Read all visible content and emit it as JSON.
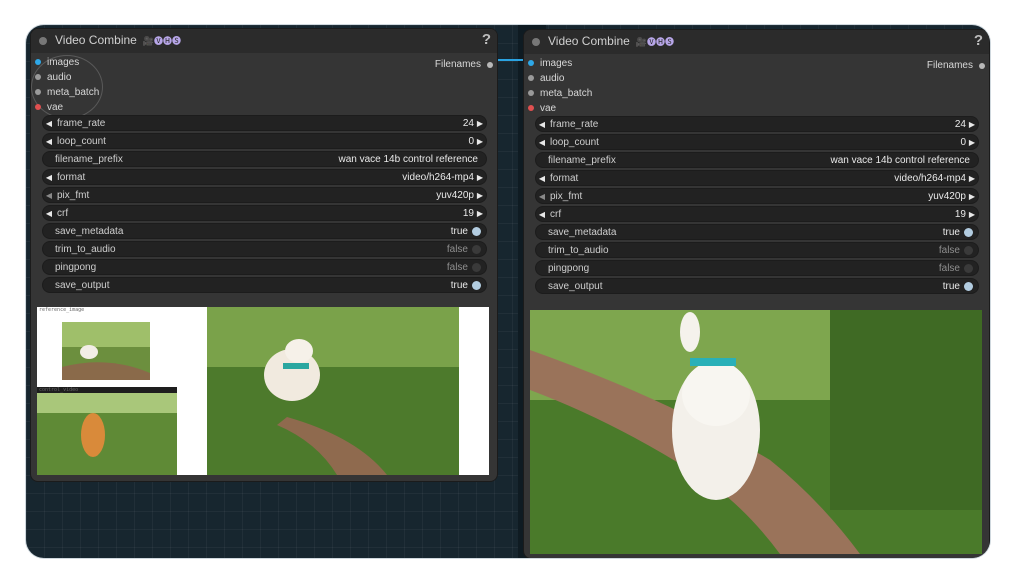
{
  "nodes": [
    {
      "title": "Video Combine",
      "badge": "🎥🅥🅗🅢",
      "help": "?",
      "inputs": [
        {
          "label": "images"
        },
        {
          "label": "audio"
        },
        {
          "label": "meta_batch"
        },
        {
          "label": "vae"
        }
      ],
      "output": "Filenames",
      "widgets": [
        {
          "label": "frame_rate",
          "value": "24"
        },
        {
          "label": "loop_count",
          "value": "0"
        },
        {
          "label": "filename_prefix",
          "value": "wan vace 14b control reference"
        },
        {
          "label": "format",
          "value": "video/h264-mp4"
        },
        {
          "label": "pix_fmt",
          "value": "yuv420p"
        },
        {
          "label": "crf",
          "value": "19"
        },
        {
          "label": "save_metadata",
          "value": "true"
        },
        {
          "label": "trim_to_audio",
          "value": "false"
        },
        {
          "label": "pingpong",
          "value": "false"
        },
        {
          "label": "save_output",
          "value": "true"
        }
      ],
      "preview_captions": [
        "reference_image",
        "control_video"
      ]
    },
    {
      "title": "Video Combine",
      "badge": "🎥🅥🅗🅢",
      "help": "?",
      "inputs": [
        {
          "label": "images"
        },
        {
          "label": "audio"
        },
        {
          "label": "meta_batch"
        },
        {
          "label": "vae"
        }
      ],
      "output": "Filenames",
      "widgets": [
        {
          "label": "frame_rate",
          "value": "24"
        },
        {
          "label": "loop_count",
          "value": "0"
        },
        {
          "label": "filename_prefix",
          "value": "wan vace 14b control reference"
        },
        {
          "label": "format",
          "value": "video/h264-mp4"
        },
        {
          "label": "pix_fmt",
          "value": "yuv420p"
        },
        {
          "label": "crf",
          "value": "19"
        },
        {
          "label": "save_metadata",
          "value": "true"
        },
        {
          "label": "trim_to_audio",
          "value": "false"
        },
        {
          "label": "pingpong",
          "value": "false"
        },
        {
          "label": "save_output",
          "value": "true"
        }
      ]
    }
  ],
  "colors": {
    "canvas": "#17262f",
    "node": "#353535",
    "link": "#2aa3e2",
    "toggle_on": "#b2cce0"
  }
}
